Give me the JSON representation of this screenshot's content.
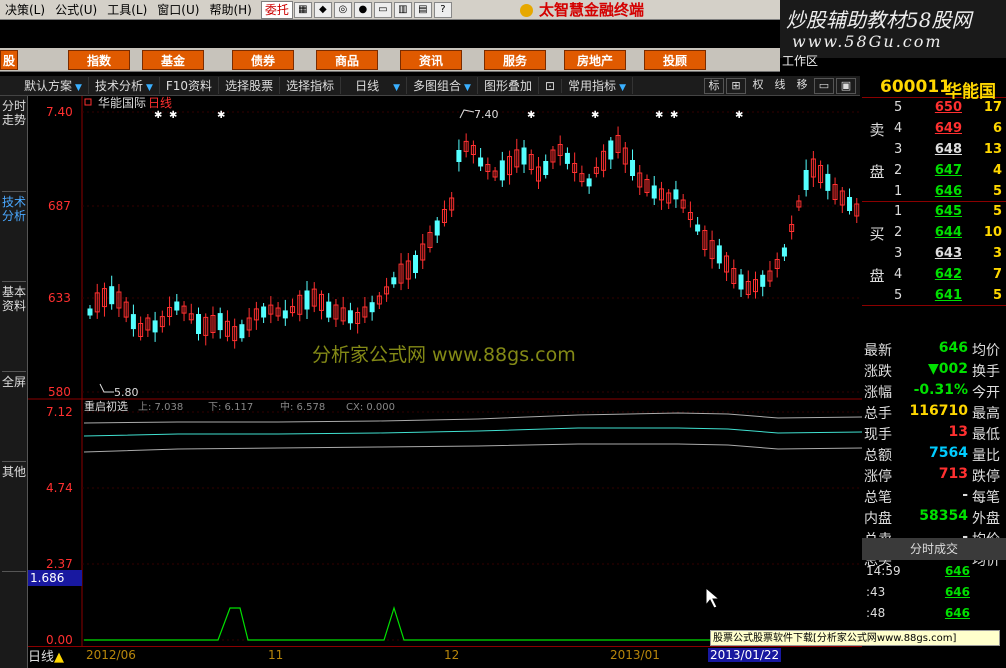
{
  "menu": {
    "items": [
      "决策(L)",
      "公式(U)",
      "工具(L)",
      "窗口(U)",
      "帮助(H)"
    ],
    "wt": "委托",
    "brand": "太智慧金融终端"
  },
  "watermark": {
    "line1": "炒股辅助教材58股网",
    "line2": "www.58Gu.com"
  },
  "sectors": [
    "股",
    "指数",
    "基金",
    "债券",
    "商品",
    "资讯",
    "服务",
    "房地产",
    "投顾"
  ],
  "workarea": "工作区",
  "toolbar": {
    "items": [
      "默认方案",
      "技术分析",
      "F10资料",
      "选择股票",
      "选择指标",
      "日线",
      "多图组合",
      "图形叠加",
      "常用指标"
    ],
    "icons": [
      "标",
      "田",
      "权",
      "线",
      "移"
    ]
  },
  "lefttabs": [
    "分时走势",
    "技术分析",
    "基本资料",
    "全屏",
    "其他"
  ],
  "stock": {
    "code": "600011",
    "name": "华能国"
  },
  "main_chart": {
    "title": "华能国际",
    "period": "日线",
    "ymax": "7.40",
    "ymid1": "687",
    "ymid2": "633",
    "ymin": "580",
    "hi_label": "7.40",
    "lo_label": "5.80",
    "ad_watermark": "分析家公式网 www.88gs.com"
  },
  "indicator": {
    "name": "重启初选",
    "up": "上: 7.038",
    "down": "下: 6.117",
    "mid": "中: 6.578",
    "cx": "CX: 0.000",
    "y1": "7.12",
    "y2": "4.74",
    "y3": "2.37",
    "y4": "0.00",
    "cursor": "1.686"
  },
  "sell": [
    {
      "lv": "5",
      "p": "650",
      "v": "17"
    },
    {
      "lv": "4",
      "p": "649",
      "v": "6"
    },
    {
      "lv": "3",
      "p": "648",
      "v": "13"
    },
    {
      "lv": "2",
      "p": "647",
      "v": "4"
    },
    {
      "lv": "1",
      "p": "646",
      "v": "5"
    }
  ],
  "sell_label": [
    "卖",
    "盘"
  ],
  "buy": [
    {
      "lv": "1",
      "p": "645",
      "v": "5"
    },
    {
      "lv": "2",
      "p": "644",
      "v": "10"
    },
    {
      "lv": "3",
      "p": "643",
      "v": "3"
    },
    {
      "lv": "4",
      "p": "642",
      "v": "7"
    },
    {
      "lv": "5",
      "p": "641",
      "v": "5"
    }
  ],
  "buy_label": [
    "买",
    "盘"
  ],
  "quote": [
    {
      "a": "最新",
      "b": "646",
      "c": "均价",
      "color": "#00e000"
    },
    {
      "a": "涨跌",
      "b": "▼002",
      "c": "换手",
      "color": "#00e000"
    },
    {
      "a": "涨幅",
      "b": "-0.31%",
      "c": "今开",
      "color": "#00e000"
    },
    {
      "a": "总手",
      "b": "116710",
      "c": "最高",
      "color": "#ffd700"
    },
    {
      "a": "现手",
      "b": "13",
      "c": "最低",
      "color": "#ff3030"
    },
    {
      "a": "总额",
      "b": "7564",
      "c": "量比",
      "color": "#00ccff"
    },
    {
      "a": "涨停",
      "b": "713",
      "c": "跌停",
      "color": "#ff3030"
    },
    {
      "a": "总笔",
      "b": "-",
      "c": "每笔",
      "color": "#ddd"
    },
    {
      "a": "内盘",
      "b": "58354",
      "c": "外盘",
      "color": "#00e000"
    },
    {
      "a": "总卖",
      "b": "-",
      "c": "均价",
      "color": "#ddd"
    },
    {
      "a": "总买",
      "b": "-",
      "c": "均价",
      "color": "#ddd"
    }
  ],
  "trades_hdr": "分时成交",
  "trades": [
    {
      "t": "14:59",
      "p": "646"
    },
    {
      "t": ":43",
      "p": "646"
    },
    {
      "t": ":48",
      "p": "646"
    }
  ],
  "footer_ad": "股票公式股票软件下载[分析家公式网www.88gs.com]",
  "dates": [
    "2012/06",
    "11",
    "12",
    "2013/01",
    "2013/01/22"
  ],
  "period_label": "日线",
  "colors": {
    "up": "#ff3030",
    "down": "#54ffff",
    "axis": "#8b0000"
  }
}
